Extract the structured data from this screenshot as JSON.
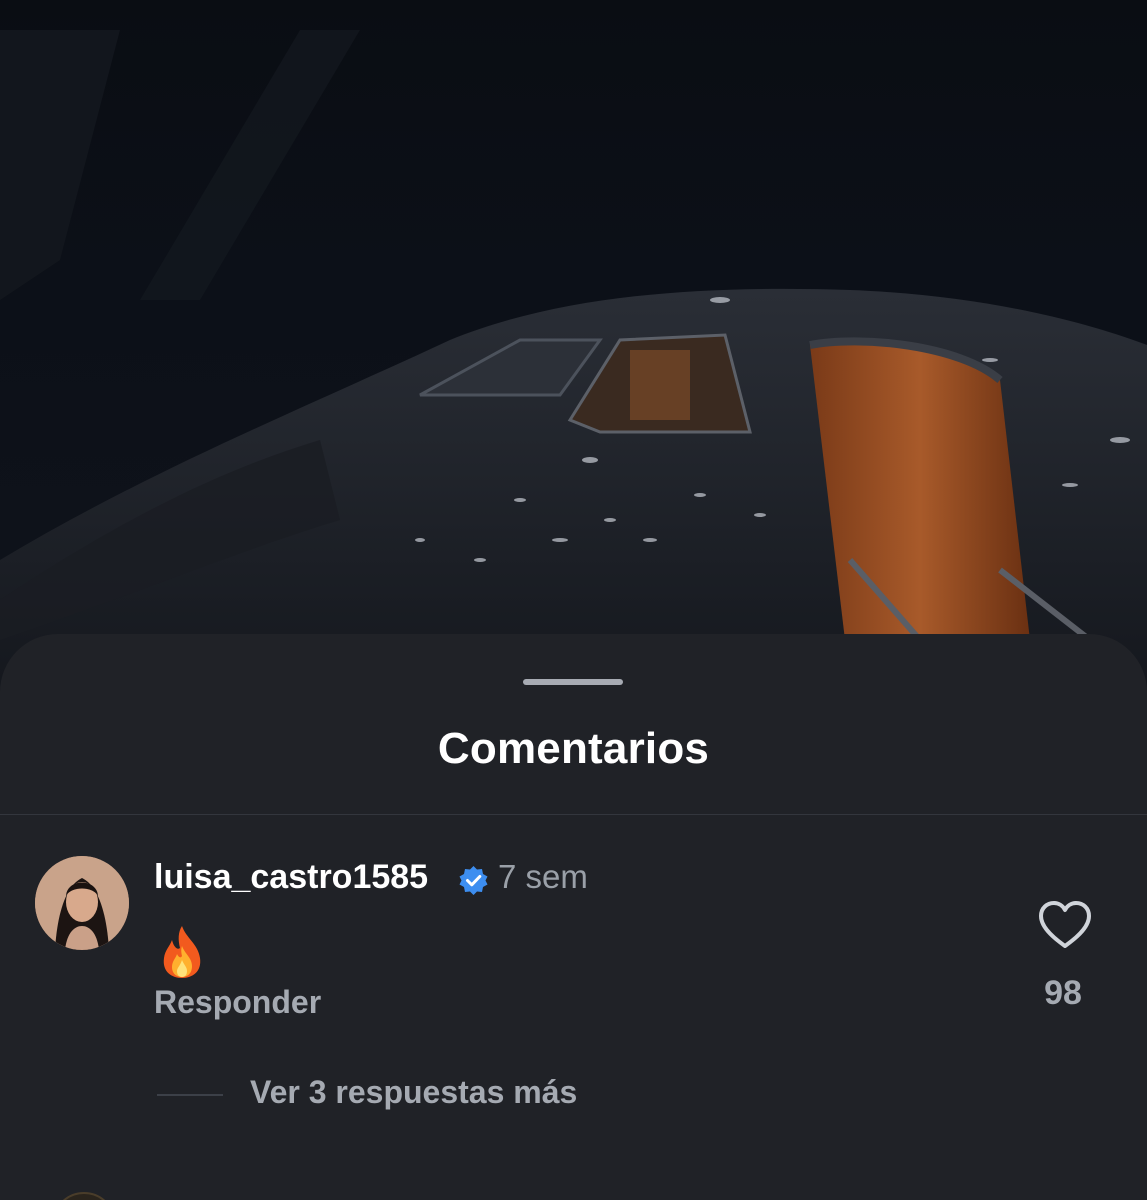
{
  "sheet": {
    "title": "Comentarios"
  },
  "comment": {
    "username": "luisa_castro1585",
    "verified": true,
    "time": "7 sem",
    "text_emoji": "fire-emoji",
    "reply_label": "Responder",
    "like_count": "98",
    "view_replies_label": "Ver 3 respuestas más"
  },
  "colors": {
    "sheet_bg": "#202227",
    "verified_blue": "#3d8ef0",
    "secondary_text": "#a5aab2"
  },
  "icons": {
    "verified": "verified-badge-icon",
    "like": "heart-outline-icon",
    "grabber": "drag-handle-icon"
  }
}
